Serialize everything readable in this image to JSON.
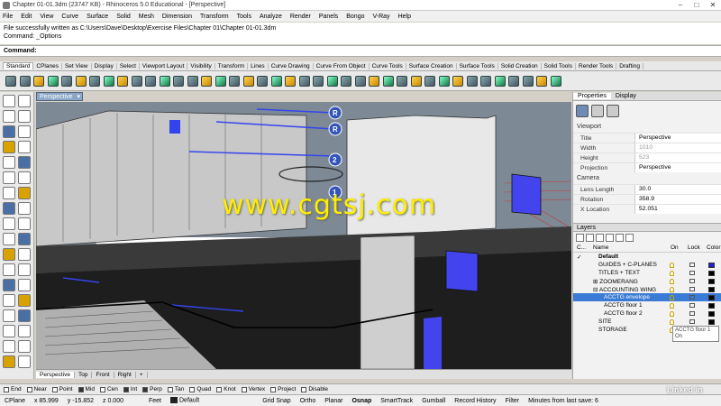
{
  "window": {
    "title": "Chapter 01-01.3dm (23747 KB) - Rhinoceros 5.0 Educational - [Perspective]",
    "controls": [
      "–",
      "□",
      "✕"
    ]
  },
  "menu": [
    "File",
    "Edit",
    "View",
    "Curve",
    "Surface",
    "Solid",
    "Mesh",
    "Dimension",
    "Transform",
    "Tools",
    "Analyze",
    "Render",
    "Panels",
    "Bongo",
    "V-Ray",
    "Help"
  ],
  "command_history": [
    "File successfully written as C:\\Users\\Dave\\Desktop\\Exercise Files\\Chapter 01\\Chapter 01-01.3dm",
    "Command: _Options"
  ],
  "command_prompt": "Command:",
  "toolbar_tabs": [
    "Standard",
    "CPlanes",
    "Set View",
    "Display",
    "Select",
    "Viewport Layout",
    "Visibility",
    "Transform",
    "Lines",
    "Curve Drawing",
    "Curve From Object",
    "Curve Tools",
    "Surface Creation",
    "Surface Tools",
    "Solid Creation",
    "Solid Tools",
    "Render Tools",
    "Drafting"
  ],
  "viewport": {
    "label": "Perspective",
    "markers": [
      "R",
      "R",
      "2",
      "1"
    ],
    "watermark": "www.cgtsj.com"
  },
  "view_tabs": [
    "Perspective",
    "Top",
    "Front",
    "Right",
    "+"
  ],
  "panel": {
    "tabs": [
      "Properties",
      "Display"
    ],
    "section_viewport": "Viewport",
    "props": [
      {
        "k": "Title",
        "v": "Perspective"
      },
      {
        "k": "Width",
        "v": "1010"
      },
      {
        "k": "Height",
        "v": "523"
      },
      {
        "k": "Projection",
        "v": "Perspective"
      }
    ],
    "section_camera": "Camera",
    "camera_props": [
      {
        "k": "Lens Length",
        "v": "30.0"
      },
      {
        "k": "Rotation",
        "v": "358.9"
      },
      {
        "k": "X Location",
        "v": "52.051"
      }
    ]
  },
  "layers": {
    "title": "Layers",
    "columns": [
      "C...",
      "Name",
      "On",
      "Lock",
      "Color"
    ],
    "rows": [
      {
        "name": "Default",
        "bold": true,
        "indent": 1,
        "color": "#000000"
      },
      {
        "name": "GUIDES + C-PLANES",
        "indent": 1,
        "color": "#2222cc"
      },
      {
        "name": "TITLES + TEXT",
        "indent": 1,
        "color": "#000000"
      },
      {
        "name": "⊞ ZOOMERANG",
        "indent": 0,
        "color": "#000000"
      },
      {
        "name": "⊟ ACCOUNTING WING",
        "indent": 0,
        "color": "#000000"
      },
      {
        "name": "ACCTG envelope",
        "indent": 2,
        "color": "#000000",
        "selected": true
      },
      {
        "name": "ACCTG floor 1",
        "indent": 2,
        "color": "#000000"
      },
      {
        "name": "ACCTG floor 2",
        "indent": 2,
        "color": "#000000"
      },
      {
        "name": "SITE",
        "indent": 1,
        "color": "#000000"
      },
      {
        "name": "STORAGE",
        "indent": 1,
        "color": "#000000"
      }
    ],
    "tooltip": [
      "ACCTG floor 1",
      "On"
    ]
  },
  "osnap": [
    {
      "label": "End",
      "on": false
    },
    {
      "label": "Near",
      "on": false
    },
    {
      "label": "Point",
      "on": false
    },
    {
      "label": "Mid",
      "on": true
    },
    {
      "label": "Cen",
      "on": false
    },
    {
      "label": "Int",
      "on": true
    },
    {
      "label": "Perp",
      "on": true
    },
    {
      "label": "Tan",
      "on": false
    },
    {
      "label": "Quad",
      "on": false
    },
    {
      "label": "Knot",
      "on": false
    },
    {
      "label": "Vertex",
      "on": false
    },
    {
      "label": "Project",
      "on": false
    },
    {
      "label": "Disable",
      "on": false
    }
  ],
  "status": {
    "cplane": "CPlane",
    "x": "x 85.999",
    "y": "y -15.852",
    "z": "z 0.000",
    "units": "Feet",
    "layer": "Default",
    "toggles": [
      "Grid Snap",
      "Ortho",
      "Planar",
      "Osnap",
      "SmartTrack",
      "Gumball",
      "Record History",
      "Filter"
    ],
    "message": "Minutes from last save: 6"
  },
  "brand": "Linked in",
  "colors": {
    "accent": "#3a7bd5",
    "guide_blue": "#4444ee",
    "ground_green": "#00a050",
    "watermark": "#ffee00"
  }
}
